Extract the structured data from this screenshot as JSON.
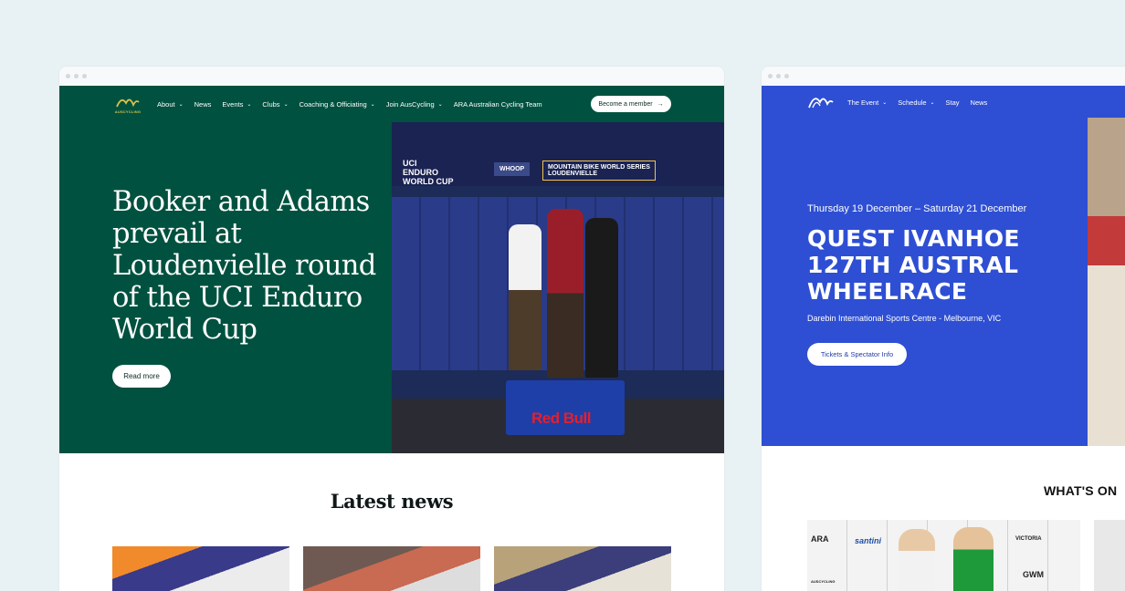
{
  "left_site": {
    "logo_text": "AUSCYCLING",
    "nav": [
      {
        "label": "About",
        "has_dropdown": true
      },
      {
        "label": "News",
        "has_dropdown": false
      },
      {
        "label": "Events",
        "has_dropdown": true
      },
      {
        "label": "Clubs",
        "has_dropdown": true
      },
      {
        "label": "Coaching & Officiating",
        "has_dropdown": true
      },
      {
        "label": "Join AusCycling",
        "has_dropdown": true
      },
      {
        "label": "ARA Australian Cycling Team",
        "has_dropdown": false
      }
    ],
    "cta_label": "Become a member",
    "cta_icon": "arrow-right-icon",
    "hero_title": "Booker and Adams prevail at Loudenvielle round of the UCI Enduro World Cup",
    "read_more": "Read more",
    "photo": {
      "banner_line1": "UCI",
      "banner_line2": "ENDURO",
      "banner_line3": "WORLD CUP",
      "sponsor1": "WHOOP",
      "sponsor2": "MOUNTAIN BIKE WORLD SERIES",
      "sponsor3": "LOUDENVIELLE",
      "podium_sponsor": "Red Bull"
    },
    "section_title": "Latest news",
    "accent_color": "#00513f"
  },
  "right_site": {
    "nav": [
      {
        "label": "The Event",
        "has_dropdown": true
      },
      {
        "label": "Schedule",
        "has_dropdown": true
      },
      {
        "label": "Stay",
        "has_dropdown": false
      },
      {
        "label": "News",
        "has_dropdown": false
      }
    ],
    "date": "Thursday 19 December – Saturday 21 December",
    "title": "QUEST IVANHOE 127TH AUSTRAL WHEELRACE",
    "venue": "Darebin International Sports Centre - Melbourne, VIC",
    "button": "Tickets & Spectator Info",
    "section_title": "WHAT'S ON",
    "card_logos": [
      "ARA",
      "santini",
      "VICTORIA",
      "GWM",
      "AUSCYCLING"
    ],
    "accent_color": "#2e4fd3"
  }
}
